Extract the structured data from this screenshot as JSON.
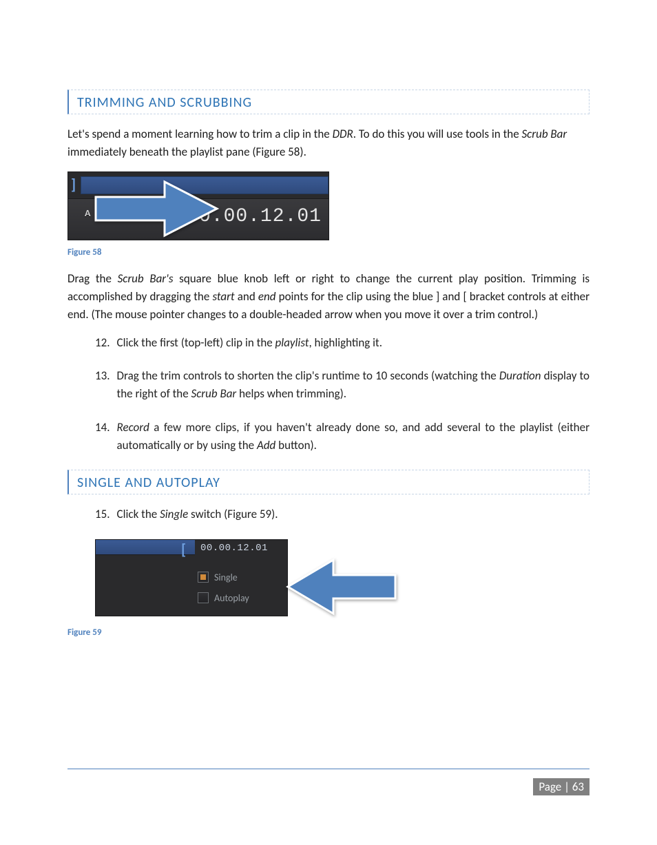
{
  "sections": {
    "s1": {
      "heading": "TRIMMING AND SCRUBBING"
    },
    "s2": {
      "heading": "SINGLE AND AUTOPLAY"
    }
  },
  "paras": {
    "intro_a": "Let's spend a moment learning how to trim a clip in the ",
    "intro_em1": "DDR",
    "intro_b": ".  To do this you will use tools in the ",
    "intro_em2": "Scrub Bar",
    "intro_c": " immediately beneath the playlist pane (Figure 58).",
    "drag_a": "Drag the ",
    "drag_em1": "Scrub Bar's",
    "drag_b": " square blue knob left or right to change the current play position. Trimming is accomplished by dragging the ",
    "drag_em2": "start",
    "drag_c": " and ",
    "drag_em3": "end",
    "drag_d": " points for the clip using the blue ] and [ bracket controls at either end.  (The mouse pointer changes to a double-headed arrow when you move it over a trim control.)"
  },
  "list": {
    "n12": "12.",
    "t12_a": "Click the first (top-left) clip in the ",
    "t12_em": "playlist",
    "t12_b": ", highlighting it.",
    "n13": "13.",
    "t13_a": "Drag the trim controls to shorten the clip's runtime to 10 seconds (watching the ",
    "t13_em": "Duration",
    "t13_b": " display to the right of the ",
    "t13_em2": "Scrub Bar",
    "t13_c": " helps when trimming).",
    "n14": "14.",
    "t14_em": "Record",
    "t14_a": " a few more clips, if you haven't already done so, and add several to the playlist (either automatically or by using the ",
    "t14_em2": "Add",
    "t14_b": " button).",
    "n15": "15.",
    "t15_a": "Click the ",
    "t15_em": "Single",
    "t15_b": " switch (Figure 59)."
  },
  "fig58": {
    "caption": "Figure 58",
    "timecode": "00.00.12.01",
    "label_a": "A"
  },
  "fig59": {
    "caption": "Figure 59",
    "timecode": "00.00.12.01",
    "single": "Single",
    "autoplay": "Autoplay"
  },
  "footer": {
    "page_label": "Page | 63"
  }
}
